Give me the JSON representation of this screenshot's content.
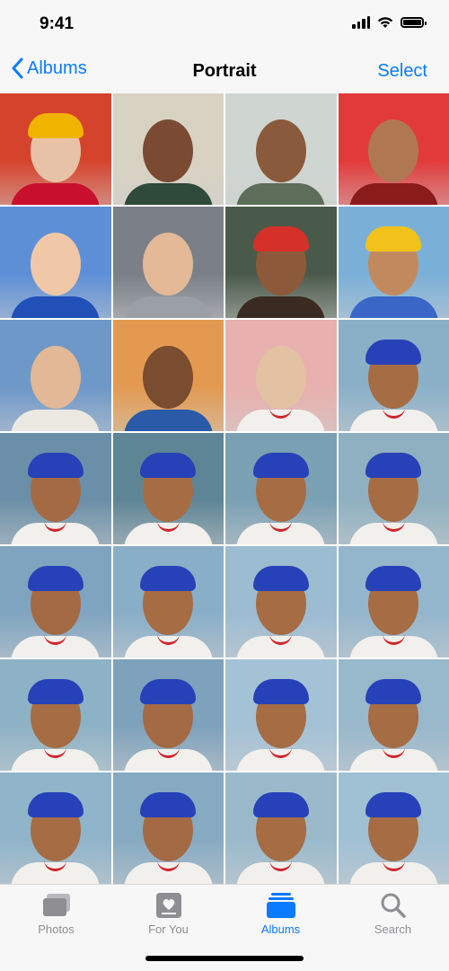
{
  "status": {
    "time": "9:41"
  },
  "nav": {
    "back_label": "Albums",
    "title": "Portrait",
    "select_label": "Select"
  },
  "tabs": [
    {
      "label": "Photos",
      "icon": "photos-icon",
      "active": false
    },
    {
      "label": "For You",
      "icon": "for-you-icon",
      "active": false
    },
    {
      "label": "Albums",
      "icon": "albums-icon",
      "active": true
    },
    {
      "label": "Search",
      "icon": "search-icon",
      "active": false
    }
  ],
  "colors": {
    "accent": "#0a7aff",
    "inactive": "#8e8e93"
  },
  "photos": [
    {
      "bg": "#d6432c",
      "skin": "#e8c2a6",
      "hat": "#f0b400",
      "shirt": "#c8102e"
    },
    {
      "bg": "#d8d2c2",
      "skin": "#7a4a32",
      "hat": "",
      "shirt": "#2f4a3a"
    },
    {
      "bg": "#cfd6d2",
      "skin": "#8a5a3c",
      "hat": "",
      "shirt": "#5d6d5a"
    },
    {
      "bg": "#e23a3a",
      "skin": "#b07852",
      "hat": "",
      "shirt": "#8a1b1b"
    },
    {
      "bg": "#5d8fd6",
      "skin": "#f0c8a8",
      "hat": "",
      "shirt": "#2050b8"
    },
    {
      "bg": "#7a7f88",
      "skin": "#e3b997",
      "hat": "",
      "shirt": "#9aa0a5"
    },
    {
      "bg": "#4a5a4a",
      "skin": "#8c5a3a",
      "hat": "#d6302b",
      "shirt": "#3a2a22"
    },
    {
      "bg": "#7ab0d8",
      "skin": "#c18a5e",
      "hat": "#f2c21b",
      "shirt": "#3a66c6"
    },
    {
      "bg": "#6e98c8",
      "skin": "#e2b896",
      "hat": "",
      "shirt": "#ece8e2"
    },
    {
      "bg": "#e39a50",
      "skin": "#7a4c30",
      "hat": "",
      "shirt": "#2a5aa8"
    },
    {
      "bg": "#e8b0ae",
      "skin": "#e3c2a4",
      "hat": "",
      "shirt": "#f2f0ec"
    },
    {
      "bg": "#8ab0c8",
      "skin": "#a66c44",
      "hat": "#2741b8",
      "shirt": "#f2f0ec"
    },
    {
      "bg": "#6b8fa8",
      "skin": "#a46a44",
      "hat": "#2741b8",
      "shirt": "#f2f0ec"
    },
    {
      "bg": "#5e8596",
      "skin": "#a66c44",
      "hat": "#2741b8",
      "shirt": "#f2f0ec"
    },
    {
      "bg": "#7aa0b4",
      "skin": "#a66c44",
      "hat": "#2741b8",
      "shirt": "#f2f0ec"
    },
    {
      "bg": "#8fb0c0",
      "skin": "#a66c44",
      "hat": "#2741b8",
      "shirt": "#f2f0ec"
    },
    {
      "bg": "#7fa4c0",
      "skin": "#a46a44",
      "hat": "#2741b8",
      "shirt": "#f2f0ec"
    },
    {
      "bg": "#89aec8",
      "skin": "#a66c44",
      "hat": "#2741b8",
      "shirt": "#f2f0ec"
    },
    {
      "bg": "#9cbcd2",
      "skin": "#a66c44",
      "hat": "#2741b8",
      "shirt": "#f2f0ec"
    },
    {
      "bg": "#93b6cc",
      "skin": "#a66c44",
      "hat": "#2741b8",
      "shirt": "#f2f0ec"
    },
    {
      "bg": "#8db2c6",
      "skin": "#a66c44",
      "hat": "#2741b8",
      "shirt": "#f2f0ec"
    },
    {
      "bg": "#7ea2bc",
      "skin": "#a46a44",
      "hat": "#2741b8",
      "shirt": "#f2f0ec"
    },
    {
      "bg": "#a3c2d6",
      "skin": "#a66c44",
      "hat": "#2741b8",
      "shirt": "#f2f0ec"
    },
    {
      "bg": "#98b8cc",
      "skin": "#a66c44",
      "hat": "#2741b8",
      "shirt": "#f2f0ec"
    },
    {
      "bg": "#90b4ca",
      "skin": "#a66c44",
      "hat": "#2741b8",
      "shirt": "#f2f0ec"
    },
    {
      "bg": "#86aac2",
      "skin": "#a46a44",
      "hat": "#2741b8",
      "shirt": "#f2f0ec"
    },
    {
      "bg": "#9abacc",
      "skin": "#a66c44",
      "hat": "#2741b8",
      "shirt": "#f2f0ec"
    },
    {
      "bg": "#a0c0d4",
      "skin": "#a66c44",
      "hat": "#2741b8",
      "shirt": "#f2f0ec"
    }
  ]
}
